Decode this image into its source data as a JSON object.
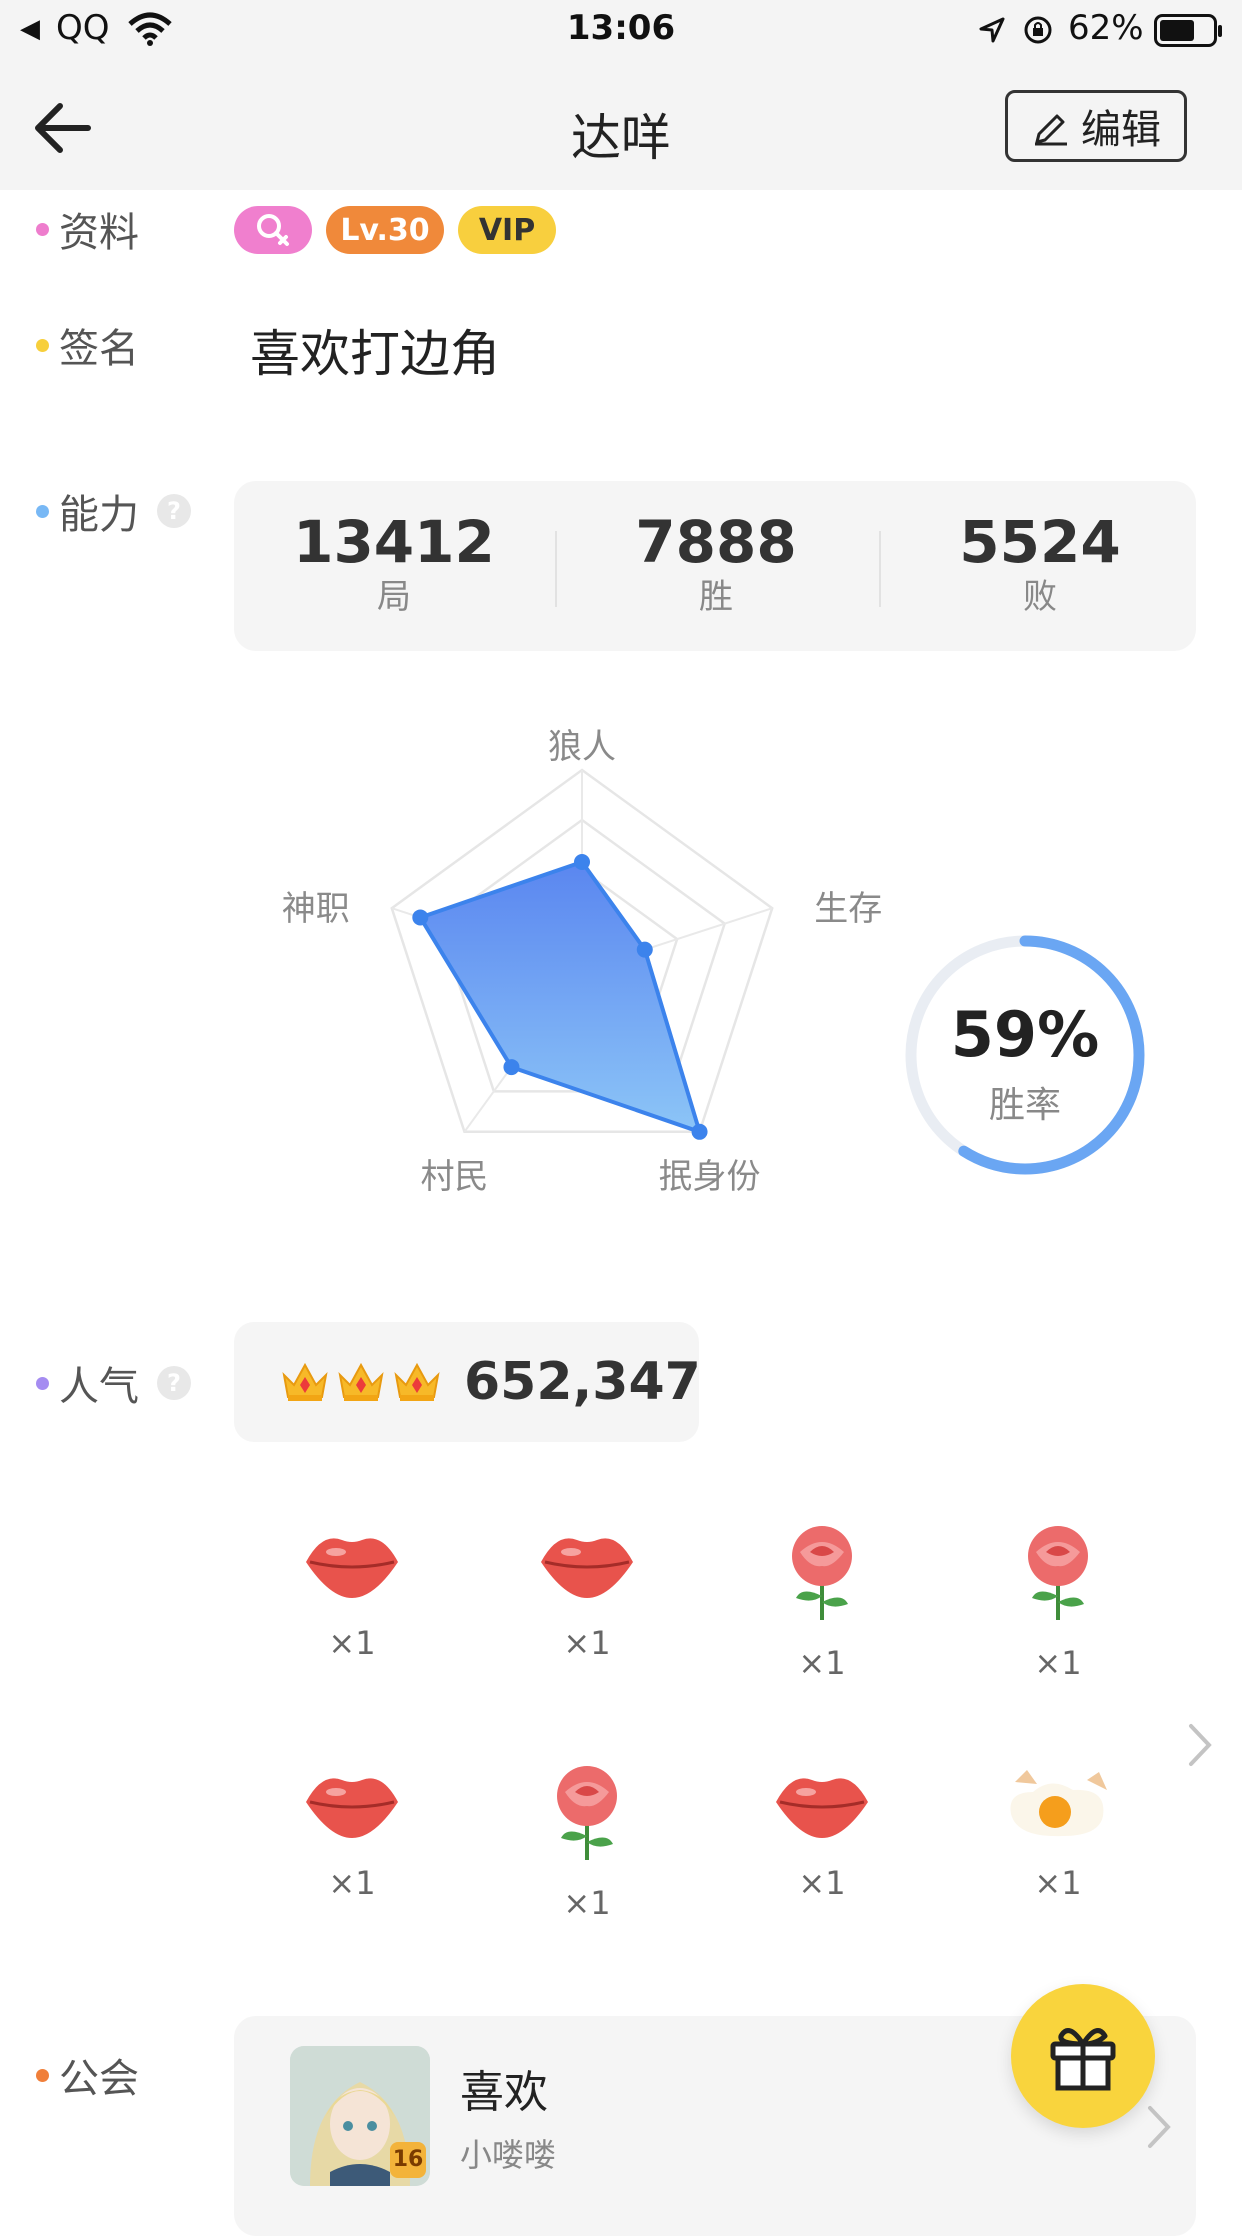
{
  "status_bar": {
    "carrier": "QQ",
    "time": "13:06",
    "battery": "62%"
  },
  "nav": {
    "title": "达咩",
    "edit_label": "编辑"
  },
  "profile": {
    "label": "资料",
    "level": "Lv.30",
    "vip": "VIP",
    "gender": "female",
    "colors": {
      "gender_badge": "#f07fce",
      "level_badge": "#f0893a",
      "vip_badge": "#f8cf3e"
    }
  },
  "signature": {
    "label": "签名",
    "text": "喜欢打边角"
  },
  "ability": {
    "label": "能力",
    "help": "?",
    "stats": [
      {
        "value": "13412",
        "label": "局"
      },
      {
        "value": "7888",
        "label": "胜"
      },
      {
        "value": "5524",
        "label": "败"
      }
    ],
    "radar": {
      "axes": [
        "狼人",
        "生存",
        "抿身份",
        "村民",
        "神职"
      ],
      "values": [
        0.54,
        0.33,
        1.0,
        0.6,
        0.85
      ]
    },
    "win_rate": {
      "text": "59%",
      "label": "胜率",
      "value": 0.59
    }
  },
  "popularity": {
    "label": "人气",
    "help": "?",
    "value": "652,347",
    "crown_count": 3,
    "gifts": [
      {
        "icon": "lips-icon",
        "count": "×1"
      },
      {
        "icon": "lips-icon",
        "count": "×1"
      },
      {
        "icon": "rose-icon",
        "count": "×1"
      },
      {
        "icon": "rose-icon",
        "count": "×1"
      },
      {
        "icon": "lips-icon",
        "count": "×1"
      },
      {
        "icon": "rose-icon",
        "count": "×1"
      },
      {
        "icon": "lips-icon",
        "count": "×1"
      },
      {
        "icon": "egg-icon",
        "count": "×1"
      }
    ]
  },
  "guild": {
    "label": "公会",
    "name": "喜欢",
    "sub": "小喽喽",
    "avatar_level": "16"
  }
}
